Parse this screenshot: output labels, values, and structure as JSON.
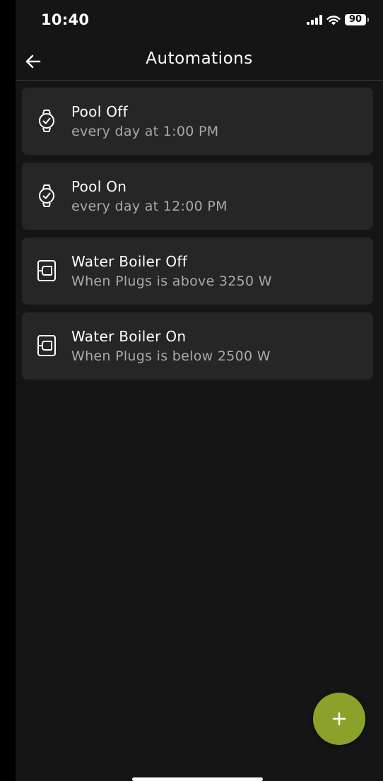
{
  "status_bar": {
    "time": "10:40",
    "battery": "90",
    "signal_icon": "cellular-signal-icon",
    "wifi_icon": "wifi-icon"
  },
  "header": {
    "title": "Automations",
    "back_icon": "arrow-left-icon"
  },
  "automations": [
    {
      "title": "Pool Off",
      "subtitle": "every day at 1:00 PM",
      "icon": "watch-icon"
    },
    {
      "title": "Pool On",
      "subtitle": "every day at 12:00 PM",
      "icon": "watch-icon"
    },
    {
      "title": "Water Boiler Off",
      "subtitle": "When Plugs is above 3250 W",
      "icon": "device-trigger-icon"
    },
    {
      "title": "Water Boiler On",
      "subtitle": "When Plugs is below 2500 W",
      "icon": "device-trigger-icon"
    }
  ],
  "fab": {
    "icon": "plus-icon"
  },
  "colors": {
    "background": "#151515",
    "card": "#262626",
    "accent": "#8ba22a",
    "subtitle": "#a9a9a9"
  }
}
